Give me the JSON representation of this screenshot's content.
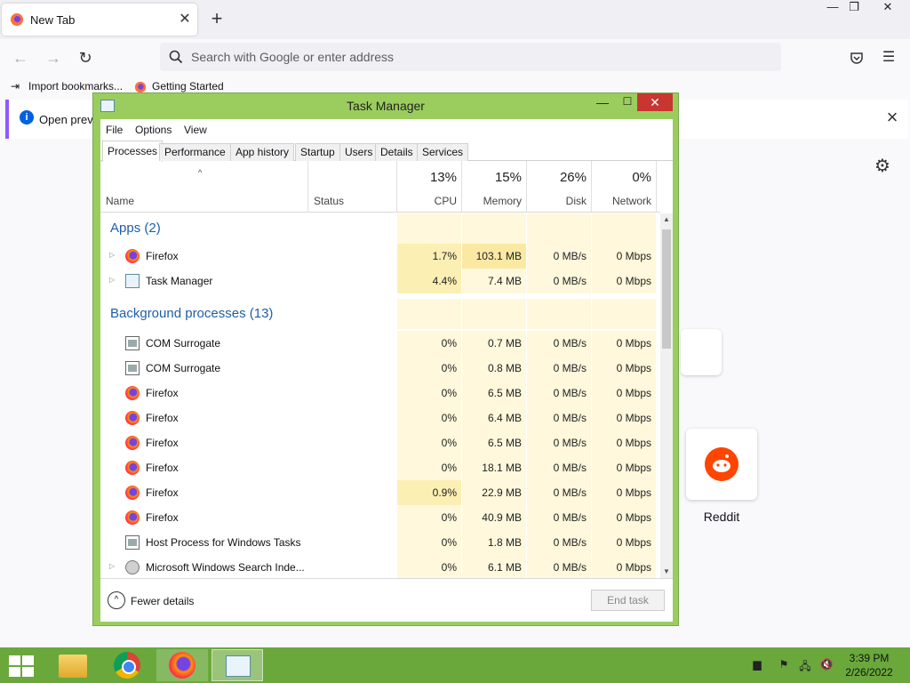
{
  "browser": {
    "tab_title": "New Tab",
    "url_placeholder": "Search with Google or enter address",
    "bookmarks": [
      "Import bookmarks...",
      "Getting Started"
    ],
    "info_text": "Open previ",
    "shortcut_label": "Reddit"
  },
  "task_manager": {
    "title": "Task Manager",
    "menu": [
      "File",
      "Options",
      "View"
    ],
    "tabs": [
      "Processes",
      "Performance",
      "App history",
      "Startup",
      "Users",
      "Details",
      "Services"
    ],
    "active_tab": "Processes",
    "columns": {
      "name": "Name",
      "status": "Status",
      "cpu_pct": "13%",
      "cpu": "CPU",
      "memory_pct": "15%",
      "memory": "Memory",
      "disk_pct": "26%",
      "disk": "Disk",
      "network_pct": "0%",
      "network": "Network"
    },
    "groups": {
      "apps": "Apps (2)",
      "background": "Background processes (13)"
    },
    "apps": [
      {
        "name": "Firefox",
        "icon": "firefox-icon",
        "expand": true,
        "cpu": "1.7%",
        "memory": "103.1 MB",
        "disk": "0 MB/s",
        "network": "0 Mbps"
      },
      {
        "name": "Task Manager",
        "icon": "task-manager-icon",
        "expand": true,
        "cpu": "4.4%",
        "memory": "7.4 MB",
        "disk": "0 MB/s",
        "network": "0 Mbps"
      }
    ],
    "background": [
      {
        "name": "COM Surrogate",
        "icon": "com-surrogate-icon",
        "expand": false,
        "cpu": "0%",
        "memory": "0.7 MB",
        "disk": "0 MB/s",
        "network": "0 Mbps"
      },
      {
        "name": "COM Surrogate",
        "icon": "com-surrogate-icon",
        "expand": false,
        "cpu": "0%",
        "memory": "0.8 MB",
        "disk": "0 MB/s",
        "network": "0 Mbps"
      },
      {
        "name": "Firefox",
        "icon": "firefox-icon",
        "expand": false,
        "cpu": "0%",
        "memory": "6.5 MB",
        "disk": "0 MB/s",
        "network": "0 Mbps"
      },
      {
        "name": "Firefox",
        "icon": "firefox-icon",
        "expand": false,
        "cpu": "0%",
        "memory": "6.4 MB",
        "disk": "0 MB/s",
        "network": "0 Mbps"
      },
      {
        "name": "Firefox",
        "icon": "firefox-icon",
        "expand": false,
        "cpu": "0%",
        "memory": "6.5 MB",
        "disk": "0 MB/s",
        "network": "0 Mbps"
      },
      {
        "name": "Firefox",
        "icon": "firefox-icon",
        "expand": false,
        "cpu": "0%",
        "memory": "18.1 MB",
        "disk": "0 MB/s",
        "network": "0 Mbps"
      },
      {
        "name": "Firefox",
        "icon": "firefox-icon",
        "expand": false,
        "cpu": "0.9%",
        "memory": "22.9 MB",
        "disk": "0 MB/s",
        "network": "0 Mbps"
      },
      {
        "name": "Firefox",
        "icon": "firefox-icon",
        "expand": false,
        "cpu": "0%",
        "memory": "40.9 MB",
        "disk": "0 MB/s",
        "network": "0 Mbps"
      },
      {
        "name": "Host Process for Windows Tasks",
        "icon": "com-surrogate-icon",
        "expand": false,
        "cpu": "0%",
        "memory": "1.8 MB",
        "disk": "0 MB/s",
        "network": "0 Mbps"
      },
      {
        "name": "Microsoft Windows Search Inde...",
        "icon": "search-indexer-icon",
        "expand": true,
        "cpu": "0%",
        "memory": "6.1 MB",
        "disk": "0 MB/s",
        "network": "0 Mbps"
      }
    ],
    "fewer_details": "Fewer details",
    "end_task": "End task"
  },
  "taskbar": {
    "time": "3:39 PM",
    "date": "2/26/2022",
    "accent": "#6aa83c"
  }
}
